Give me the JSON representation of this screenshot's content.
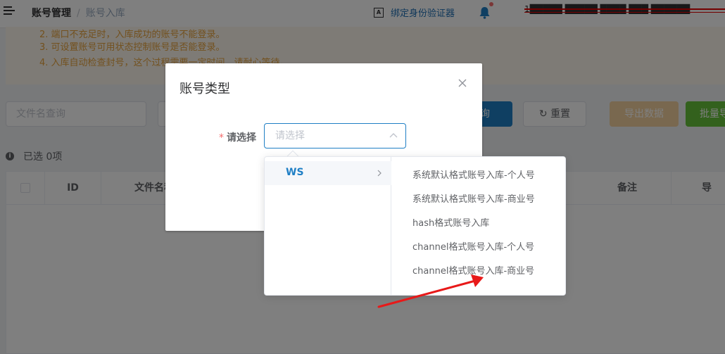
{
  "header": {
    "breadcrumb_home": "账号管理",
    "breadcrumb_sep": "/",
    "breadcrumb_current": "账号入库",
    "auth_label": "绑定身份验证器",
    "auth_icon_text": "A",
    "user_info": "1█████ █████ ████ ███ ██████"
  },
  "notice": {
    "line2": "2. 端口不充足时，入库成功的账号不能登录。",
    "line3": "3. 可设置账号可用状态控制账号是否能登录。",
    "line4": "4. 入库自动检查封号，这个过程需要一定时间，请耐心等待。"
  },
  "filters": {
    "file_placeholder": "文件名查询",
    "query_label": "查询",
    "reset_label": "重置",
    "export_label": "导出数据",
    "batch_label": "批量导"
  },
  "selection": {
    "text": "已选 0项"
  },
  "table": {
    "headers": {
      "id": "ID",
      "file": "文件名称",
      "note": "备注",
      "last": "导"
    }
  },
  "dialog": {
    "title": "账号类型",
    "required_mark": "*",
    "label": "请选择",
    "select_placeholder": "请选择"
  },
  "cascader": {
    "level1": [
      "WS"
    ],
    "level2": [
      "系统默认格式账号入库-个人号",
      "系统默认格式账号入库-商业号",
      "hash格式账号入库",
      "channel格式账号入库-个人号",
      "channel格式账号入库-商业号"
    ]
  },
  "colors": {
    "primary": "#1f7fc5",
    "warning": "#e6a23c",
    "success": "#67c23a",
    "annotation": "#e81919"
  }
}
